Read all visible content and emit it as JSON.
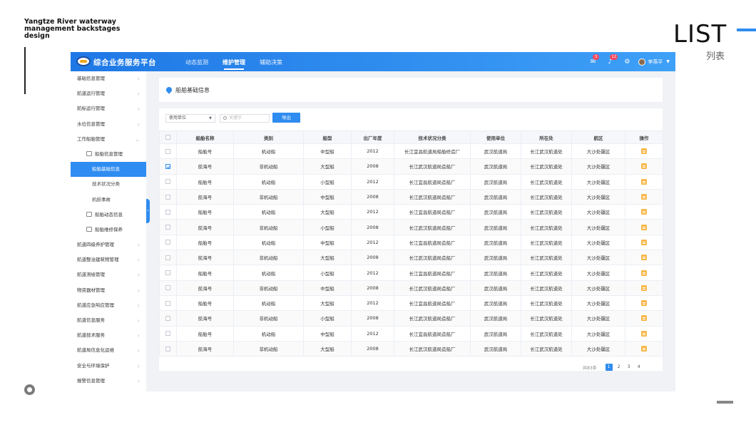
{
  "deck": {
    "title": "Yangtze River waterway management backstages design",
    "list_label": "LIST",
    "list_sub": "列表"
  },
  "app": {
    "title": "综合业务服务平台",
    "nav": [
      {
        "label": "动态监测",
        "active": false
      },
      {
        "label": "维护管理",
        "active": true
      },
      {
        "label": "辅助决策",
        "active": false
      }
    ],
    "header_icons": [
      {
        "icon": "message-icon",
        "badge": "5"
      },
      {
        "icon": "bell-icon",
        "badge": "12"
      },
      {
        "icon": "gear-icon",
        "badge": ""
      }
    ],
    "user_name": "李燕平"
  },
  "sidebar": {
    "top_items": [
      "基础信息管理",
      "航道运行管理",
      "航标运行管理",
      "水位信息管理"
    ],
    "expanded": {
      "label": "工作船舶管理",
      "group": "船舶信息管理",
      "sub_items": [
        {
          "label": "船舶基础信息",
          "active": true
        },
        {
          "label": "技术状况分类",
          "active": false
        },
        {
          "label": "机损事故",
          "active": false
        }
      ],
      "siblings": [
        "船舶动态信息",
        "船舶维修保养"
      ]
    },
    "bottom_items": [
      "航道四级养护管理",
      "航道整治建筑物管理",
      "航道测绘管理",
      "物资器材管理",
      "航道应急响应管理",
      "航道信息服务",
      "航道技术服务",
      "航道局信息化运维",
      "安全与环境保护",
      "报警信息管理"
    ]
  },
  "page": {
    "title": "船舶基础信息",
    "filter_select": "使用单位",
    "search_placeholder": "关键字",
    "export_label": "导出",
    "columns": [
      "船舶名称",
      "类别",
      "船型",
      "出厂年度",
      "技术状况分类",
      "使用单位",
      "所在处",
      "航区",
      "操作"
    ],
    "rows": [
      {
        "checked": false,
        "name": "船舶号",
        "type": "机动船",
        "size": "中型船",
        "year": "2012",
        "tech": "长江宜昌航道局船舶修造厂",
        "unit": "武汉航道局",
        "office": "长江武汉航道处",
        "area": "大沙处疆区"
      },
      {
        "checked": true,
        "name": "航海号",
        "type": "非机动船",
        "size": "大型船",
        "year": "2008",
        "tech": "长江武汉航道局造船厂",
        "unit": "武汉航道局",
        "office": "长江武汉航道处",
        "area": "大沙处疆区"
      },
      {
        "checked": false,
        "name": "船舶号",
        "type": "机动船",
        "size": "小型船",
        "year": "2012",
        "tech": "长江宜昌航道局造船厂",
        "unit": "武汉航道局",
        "office": "长江武汉航道处",
        "area": "大沙处疆区"
      },
      {
        "checked": false,
        "name": "航海号",
        "type": "非机动船",
        "size": "中型船",
        "year": "2008",
        "tech": "长江武汉航道局造船厂",
        "unit": "武汉航道局",
        "office": "长江武汉航道处",
        "area": "大沙处疆区"
      },
      {
        "checked": false,
        "name": "船舶号",
        "type": "机动船",
        "size": "大型船",
        "year": "2012",
        "tech": "长江宜昌航道局造船厂",
        "unit": "武汉航道局",
        "office": "长江武汉航道处",
        "area": "大沙处疆区"
      },
      {
        "checked": false,
        "name": "航海号",
        "type": "非机动船",
        "size": "小型船",
        "year": "2008",
        "tech": "长江武汉航道局造船厂",
        "unit": "武汉航道局",
        "office": "长江武汉航道处",
        "area": "大沙处疆区"
      },
      {
        "checked": false,
        "name": "船舶号",
        "type": "机动船",
        "size": "中型船",
        "year": "2012",
        "tech": "长江宜昌航道局造船厂",
        "unit": "武汉航道局",
        "office": "长江武汉航道处",
        "area": "大沙处疆区"
      },
      {
        "checked": false,
        "name": "航海号",
        "type": "非机动船",
        "size": "大型船",
        "year": "2008",
        "tech": "长江武汉航道局造船厂",
        "unit": "武汉航道局",
        "office": "长江武汉航道处",
        "area": "大沙处疆区"
      },
      {
        "checked": false,
        "name": "船舶号",
        "type": "机动船",
        "size": "小型船",
        "year": "2012",
        "tech": "长江宜昌航道局造船厂",
        "unit": "武汉航道局",
        "office": "长江武汉航道处",
        "area": "大沙处疆区"
      },
      {
        "checked": false,
        "name": "航海号",
        "type": "非机动船",
        "size": "中型船",
        "year": "2008",
        "tech": "长江武汉航道局造船厂",
        "unit": "武汉航道局",
        "office": "长江武汉航道处",
        "area": "大沙处疆区"
      },
      {
        "checked": false,
        "name": "船舶号",
        "type": "机动船",
        "size": "大型船",
        "year": "2012",
        "tech": "长江宜昌航道局造船厂",
        "unit": "武汉航道局",
        "office": "长江武汉航道处",
        "area": "大沙处疆区"
      },
      {
        "checked": false,
        "name": "航海号",
        "type": "非机动船",
        "size": "小型船",
        "year": "2008",
        "tech": "长江武汉航道局造船厂",
        "unit": "武汉航道局",
        "office": "长江武汉航道处",
        "area": "大沙处疆区"
      },
      {
        "checked": false,
        "name": "船舶号",
        "type": "机动船",
        "size": "中型船",
        "year": "2012",
        "tech": "长江宜昌航道局造船厂",
        "unit": "武汉航道局",
        "office": "长江武汉航道处",
        "area": "大沙处疆区"
      },
      {
        "checked": false,
        "name": "航海号",
        "type": "非机动船",
        "size": "大型船",
        "year": "2008",
        "tech": "长江武汉航道局造船厂",
        "unit": "武汉航道局",
        "office": "长江武汉航道处",
        "area": "大沙处疆区"
      }
    ],
    "pager": {
      "total": "共83条",
      "pages": [
        "1",
        "2",
        "3",
        "4"
      ],
      "current": "1"
    }
  },
  "colors": {
    "primary": "#2f8cf0",
    "badge": "#f5475f",
    "edit": "#f7b84b"
  }
}
